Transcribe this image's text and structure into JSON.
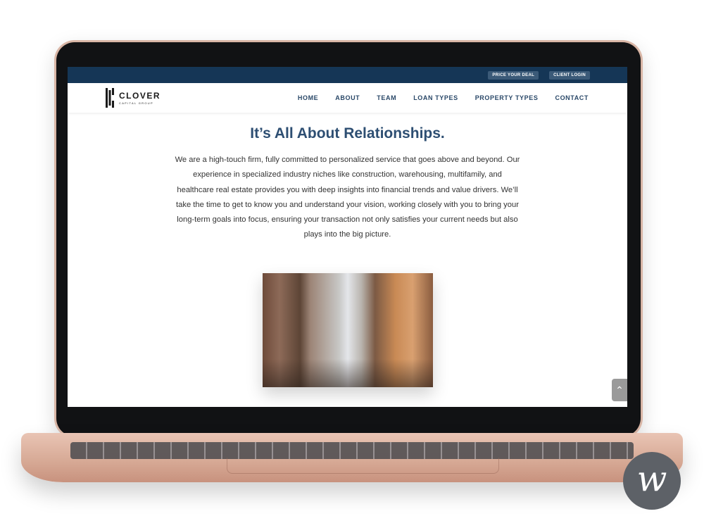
{
  "topbar": {
    "price_deal": "PRICE YOUR DEAL",
    "client_login": "CLIENT LOGIN"
  },
  "logo": {
    "name": "CLOVER",
    "subtitle": "CAPITAL GROUP"
  },
  "nav": {
    "items": [
      "HOME",
      "ABOUT",
      "TEAM",
      "LOAN TYPES",
      "PROPERTY TYPES",
      "CONTACT"
    ]
  },
  "main": {
    "headline": "It’s All About Relationships.",
    "body": "We are a high-touch firm, fully committed to personalized service that goes above and beyond. Our experience in specialized industry niches like construction, warehousing, multifamily, and healthcare real estate provides you with deep insights into financial trends and value drivers. We’ll take the time to get to know you and understand your vision, working closely with you to bring your long-term goals into focus, ensuring your transaction not only satisfies your current needs but also plays into the big picture."
  },
  "icons": {
    "scroll_top": "chevron-up-icon",
    "badge_glyph": "w"
  },
  "colors": {
    "topbar": "#153656",
    "accent": "#2d4e72",
    "laptop": "#d6a894"
  }
}
